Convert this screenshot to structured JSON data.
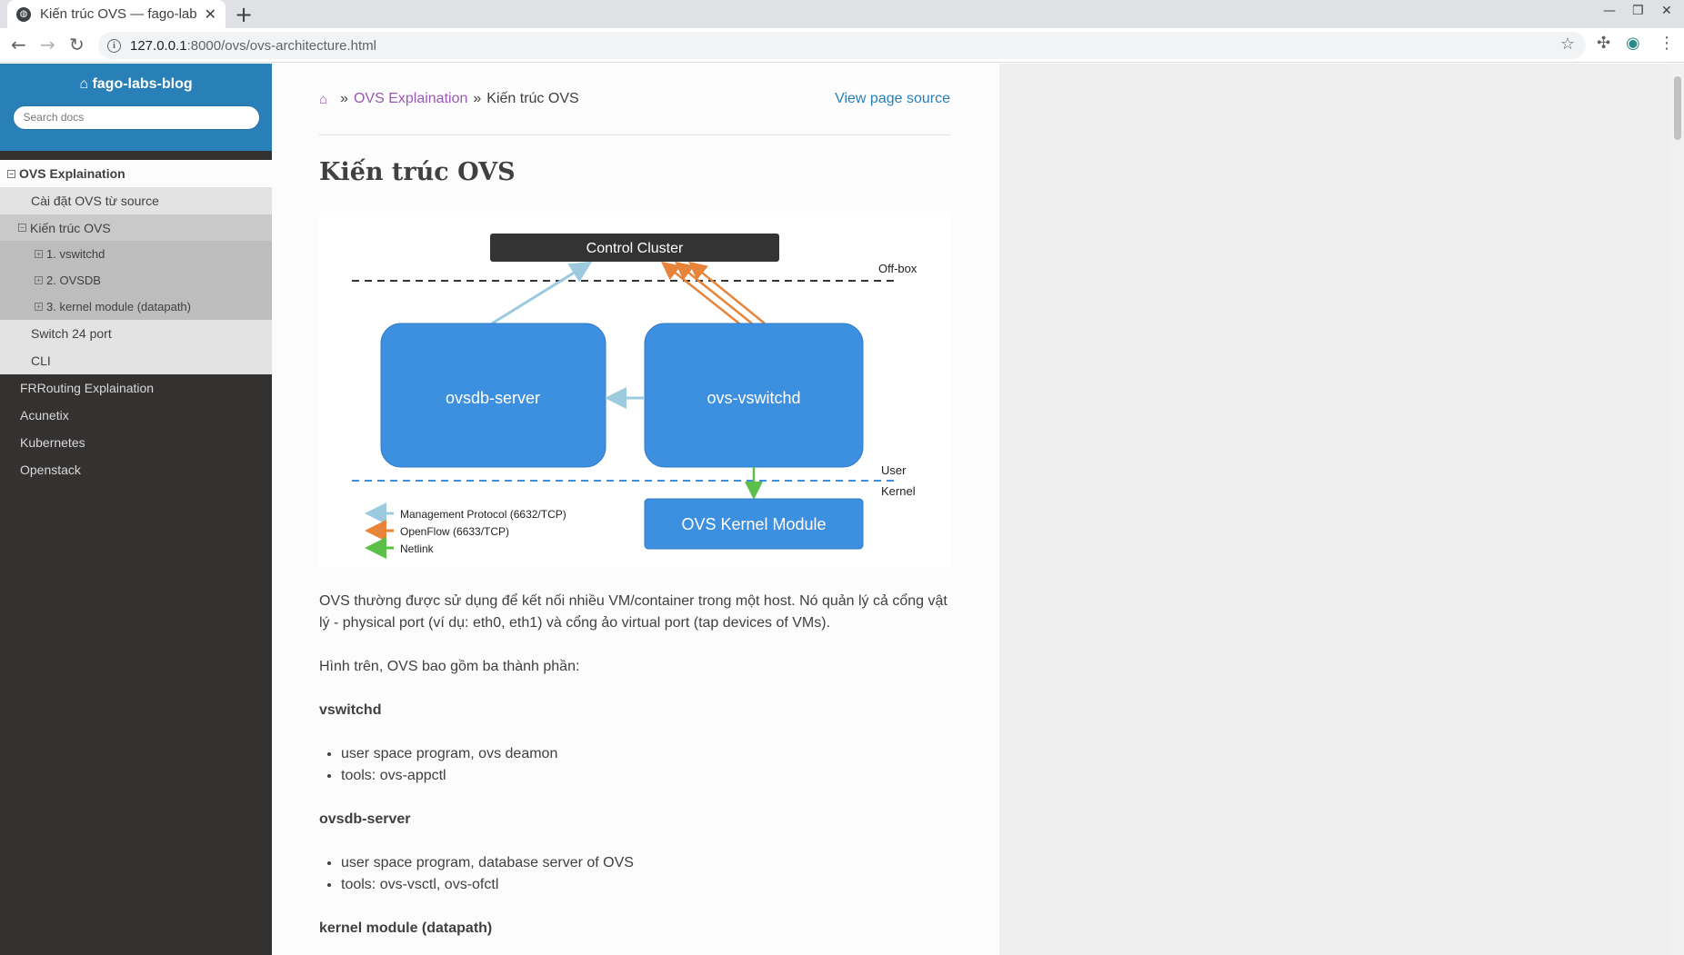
{
  "browser": {
    "tab_title": "Kiến trúc OVS — fago-lab",
    "tab_close": "✕",
    "new_tab": "+",
    "url_host": "127.0.0.1",
    "url_rest": ":8000/ovs/ovs-architecture.html"
  },
  "sidebar": {
    "brand": "fago-labs-blog",
    "search_placeholder": "Search docs",
    "items": [
      {
        "label": "OVS Explaination",
        "level": "l1-current",
        "toggle": "−"
      },
      {
        "label": "Cài đặt OVS từ source",
        "level": "l2"
      },
      {
        "label": "Kiến trúc OVS",
        "level": "l2-current",
        "toggle": "−"
      },
      {
        "label": "1. vswitchd",
        "level": "l3",
        "toggle": "+"
      },
      {
        "label": "2. OVSDB",
        "level": "l3",
        "toggle": "+"
      },
      {
        "label": "3. kernel module (datapath)",
        "level": "l3",
        "toggle": "+"
      },
      {
        "label": "Switch 24 port",
        "level": "l2"
      },
      {
        "label": "CLI",
        "level": "l2"
      },
      {
        "label": "FRRouting Explaination",
        "level": "l1"
      },
      {
        "label": "Acunetix",
        "level": "l1"
      },
      {
        "label": "Kubernetes",
        "level": "l1"
      },
      {
        "label": "Openstack",
        "level": "l1"
      }
    ]
  },
  "breadcrumb": {
    "sep": "»",
    "parent": "OVS Explaination",
    "current": "Kiến trúc OVS",
    "view_source": "View page source"
  },
  "page": {
    "title": "Kiến trúc OVS",
    "para1": "OVS thường được sử dụng để kết nối nhiều VM/container trong một host. Nó quản lý cả cổng vật lý - physical port (ví dụ: eth0, eth1) và cổng ảo virtual port (tap devices of VMs).",
    "para2": "Hình trên, OVS bao gồm ba thành phần:",
    "sec_vswitchd": "vswitchd",
    "vswitchd_items": [
      "user space program, ovs deamon",
      "tools: ovs-appctl"
    ],
    "sec_ovsdb": "ovsdb-server",
    "ovsdb_items": [
      "user space program, database server of OVS",
      "tools: ovs-vsctl, ovs-ofctl"
    ],
    "sec_kernel": "kernel module (datapath)"
  },
  "diagram": {
    "control_cluster": "Control Cluster",
    "off_box": "Off-box",
    "ovsdb_server": "ovsdb-server",
    "ovs_vswitchd": "ovs-vswitchd",
    "user": "User",
    "kernel": "Kernel",
    "kernel_module": "OVS Kernel Module",
    "legend_mgmt": "Management Protocol (6632/TCP)",
    "legend_openflow": "OpenFlow (6633/TCP)",
    "legend_netlink": "Netlink",
    "colors": {
      "mgmt": "#9ccbdf",
      "openflow": "#e8833a",
      "netlink": "#5cbf4a",
      "box": "#3d8fe0",
      "cluster": "#333333"
    }
  }
}
